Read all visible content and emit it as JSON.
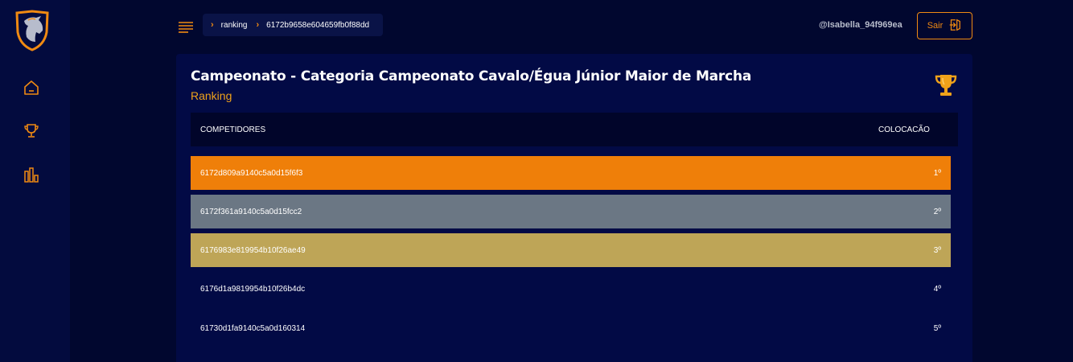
{
  "header": {
    "breadcrumb": [
      "ranking",
      "6172b9658e604659fb0f88dd"
    ],
    "user": "@Isabella_94f969ea",
    "logout_label": "Sair"
  },
  "sidebar": {
    "items": [
      {
        "icon": "home-icon"
      },
      {
        "icon": "trophy-icon"
      },
      {
        "icon": "bar-chart-icon"
      }
    ]
  },
  "card": {
    "title": "Campeonato - Categoria Campeonato Cavalo/Égua Júnior Maior de Marcha",
    "subtitle": "Ranking"
  },
  "table": {
    "columns": [
      "COMPETIDORES",
      "COLOCACÃO"
    ],
    "rows": [
      {
        "competitor": "6172d809a9140c5a0d15f6f3",
        "place": "1º",
        "color": "#ef7f09"
      },
      {
        "competitor": "6172f361a9140c5a0d15fcc2",
        "place": "2º",
        "color": "#6b7784"
      },
      {
        "competitor": "6176983e819954b10f26ae49",
        "place": "3º",
        "color": "#bea557"
      },
      {
        "competitor": "6176d1a9819954b10f26b4dc",
        "place": "4º",
        "color": ""
      },
      {
        "competitor": "61730d1fa9140c5a0d160314",
        "place": "5º",
        "color": ""
      }
    ]
  },
  "colors": {
    "accent": "#f08a12",
    "background": "#01072f",
    "card": "#020a45"
  }
}
